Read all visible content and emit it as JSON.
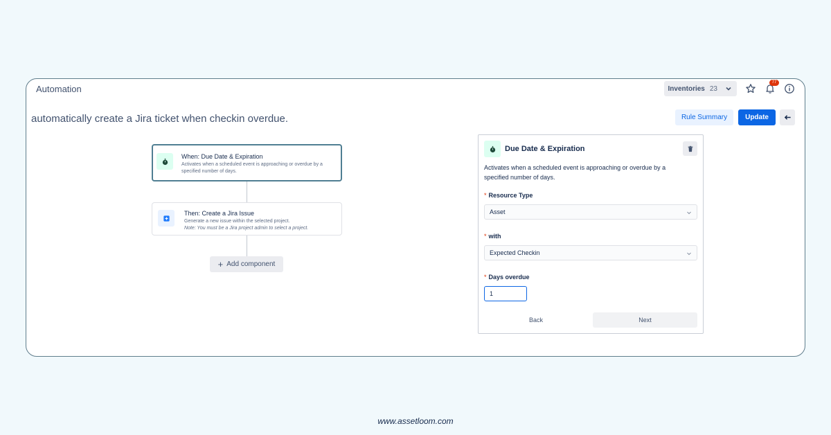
{
  "app": {
    "title": "Automation"
  },
  "topbar": {
    "inventories_label": "Inventories",
    "inventories_count": "23",
    "notification_count": "77"
  },
  "rule": {
    "title": "automatically create a Jira ticket when checkin overdue."
  },
  "actions": {
    "summary_label": "Rule Summary",
    "update_label": "Update"
  },
  "flow": {
    "trigger": {
      "title": "When: Due Date & Expiration",
      "description": "Activates when a scheduled event is approaching or overdue by a specified number of days."
    },
    "action": {
      "title": "Then: Create a Jira Issue",
      "description": "Generate a new issue within the selected project.",
      "note": "Note: You must be a Jira project admin to select a project."
    },
    "add_component_label": "Add component"
  },
  "panel": {
    "title": "Due Date & Expiration",
    "description": "Activates when a scheduled event is approaching or overdue by a specified number of days.",
    "resource_type": {
      "label": "Resource Type",
      "value": "Asset"
    },
    "with": {
      "label": "with",
      "value": "Expected Checkin"
    },
    "days_overdue": {
      "label": "Days overdue",
      "value": "1"
    },
    "back_label": "Back",
    "next_label": "Next"
  },
  "footer": {
    "text": "www.assetloom.com"
  },
  "colors": {
    "primary": "#0c66e4",
    "trigger_icon_bg": "#dcfff1",
    "action_icon_bg": "#e9f2ff",
    "required": "#de350b"
  }
}
